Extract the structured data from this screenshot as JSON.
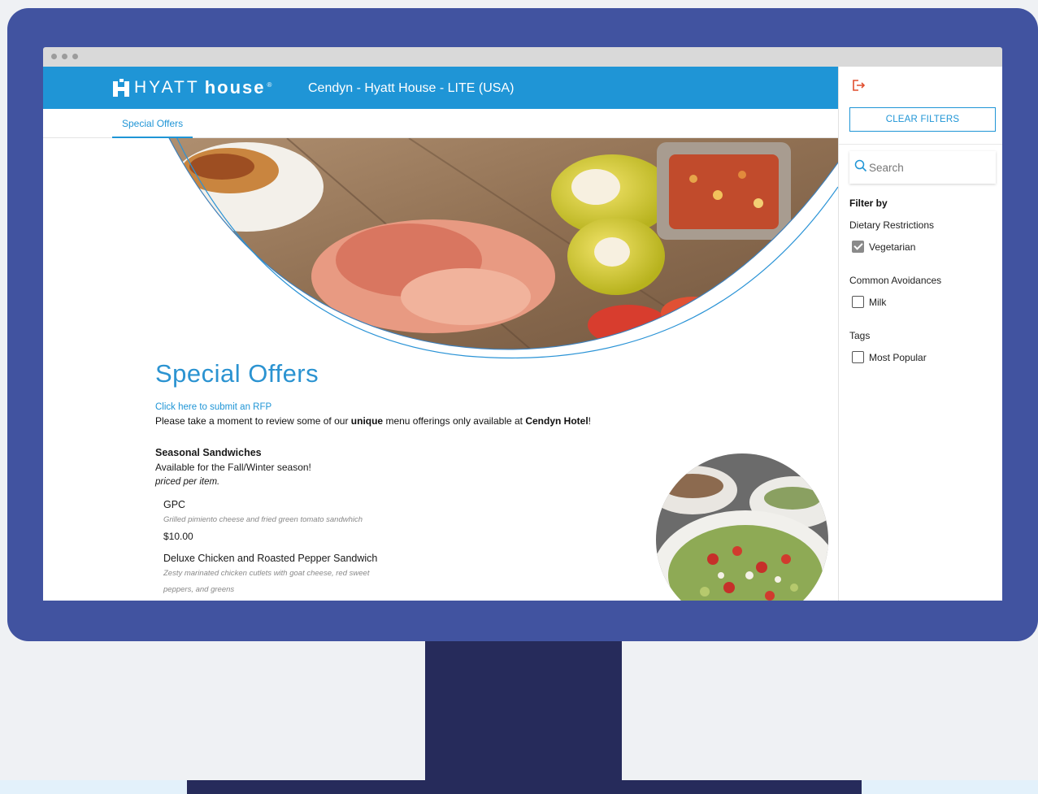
{
  "brand": {
    "logo_primary": "HYATT",
    "logo_secondary": "house",
    "logo_reg": "®",
    "site_title": "Cendyn - Hyatt House - LITE (USA)",
    "brand_color": "#1f95d6"
  },
  "nav": {
    "tabs": [
      {
        "label": "Special Offers",
        "active": true
      }
    ]
  },
  "main": {
    "title": "Special Offers",
    "rfp_link": "Click here to submit an RFP",
    "intro": {
      "before": "Please take a moment to review some of our ",
      "bold1": "unique",
      "middle": " menu offerings only available at ",
      "bold2": "Cendyn Hotel",
      "after": "!"
    },
    "sections": [
      {
        "title": "Seasonal Sandwiches",
        "subtitle": "Available for the Fall/Winter season!",
        "note": "priced per item.",
        "items": [
          {
            "name": "GPC",
            "description": "Grilled pimiento cheese and fried green tomato sandwhich",
            "price": "$10.00"
          },
          {
            "name": "Deluxe Chicken and Roasted Pepper Sandwich",
            "description": "Zesty marinated chicken cutlets with goat cheese, red sweet peppers, and greens"
          }
        ]
      }
    ]
  },
  "sidebar": {
    "logout_icon": "logout-icon",
    "clear_filters": "CLEAR FILTERS",
    "search_placeholder": "Search",
    "filter_by": "Filter by",
    "groups": [
      {
        "title": "Dietary Restrictions",
        "options": [
          {
            "label": "Vegetarian",
            "checked": true
          }
        ]
      },
      {
        "title": "Common Avoidances",
        "options": [
          {
            "label": "Milk",
            "checked": false
          }
        ]
      },
      {
        "title": "Tags",
        "options": [
          {
            "label": "Most Popular",
            "checked": false
          }
        ]
      }
    ],
    "accent_color": "#e04e2e"
  },
  "frame": {
    "monitor_color": "#4153a0",
    "stand_color": "#262b5b"
  }
}
